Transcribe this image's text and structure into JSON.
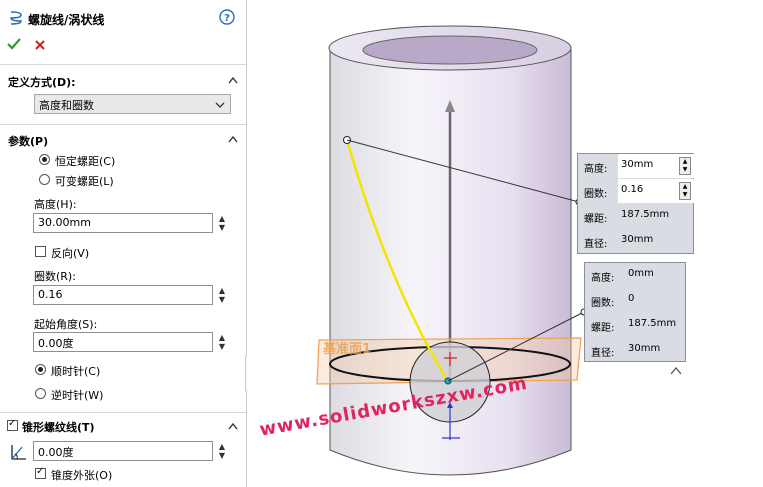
{
  "panel": {
    "title": "螺旋线/涡状线",
    "help_icon": "help-icon",
    "ok_icon": "check-icon",
    "cancel_icon": "close-icon",
    "define_section": {
      "title": "定义方式(D):",
      "selected": "高度和圈数"
    },
    "params_section": {
      "title": "参数(P)",
      "constant_pitch": "恒定螺距(C)",
      "variable_pitch": "可变螺距(L)",
      "height_label": "高度(H):",
      "height_value": "30.00mm",
      "reverse_label": "反向(V)",
      "revolutions_label": "圈数(R):",
      "revolutions_value": "0.16",
      "start_angle_label": "起始角度(S):",
      "start_angle_value": "0.00度",
      "clockwise": "顺时针(C)",
      "counterclockwise": "逆时针(W)"
    },
    "taper_section": {
      "title": "锥形螺纹线(T)",
      "angle_value": "0.00度",
      "taper_outward": "锥度外张(O)"
    }
  },
  "viewport": {
    "plane_label": "基准面1",
    "callout_top": {
      "rows": [
        {
          "label": "高度:",
          "value": "30mm"
        },
        {
          "label": "圈数:",
          "value": "0.16"
        },
        {
          "label": "螺距:",
          "value": "187.5mm"
        },
        {
          "label": "直径:",
          "value": "30mm"
        }
      ]
    },
    "callout_bottom": {
      "rows": [
        {
          "label": "高度:",
          "value": "0mm"
        },
        {
          "label": "圈数:",
          "value": "0"
        },
        {
          "label": "螺距:",
          "value": "187.5mm"
        },
        {
          "label": "直径:",
          "value": "30mm"
        }
      ]
    },
    "watermark": "www.solidworkszxw.com"
  },
  "colors": {
    "helix": "#f2e600",
    "plane": "#f0a050",
    "cylinder_tint": "#e8dff0"
  }
}
